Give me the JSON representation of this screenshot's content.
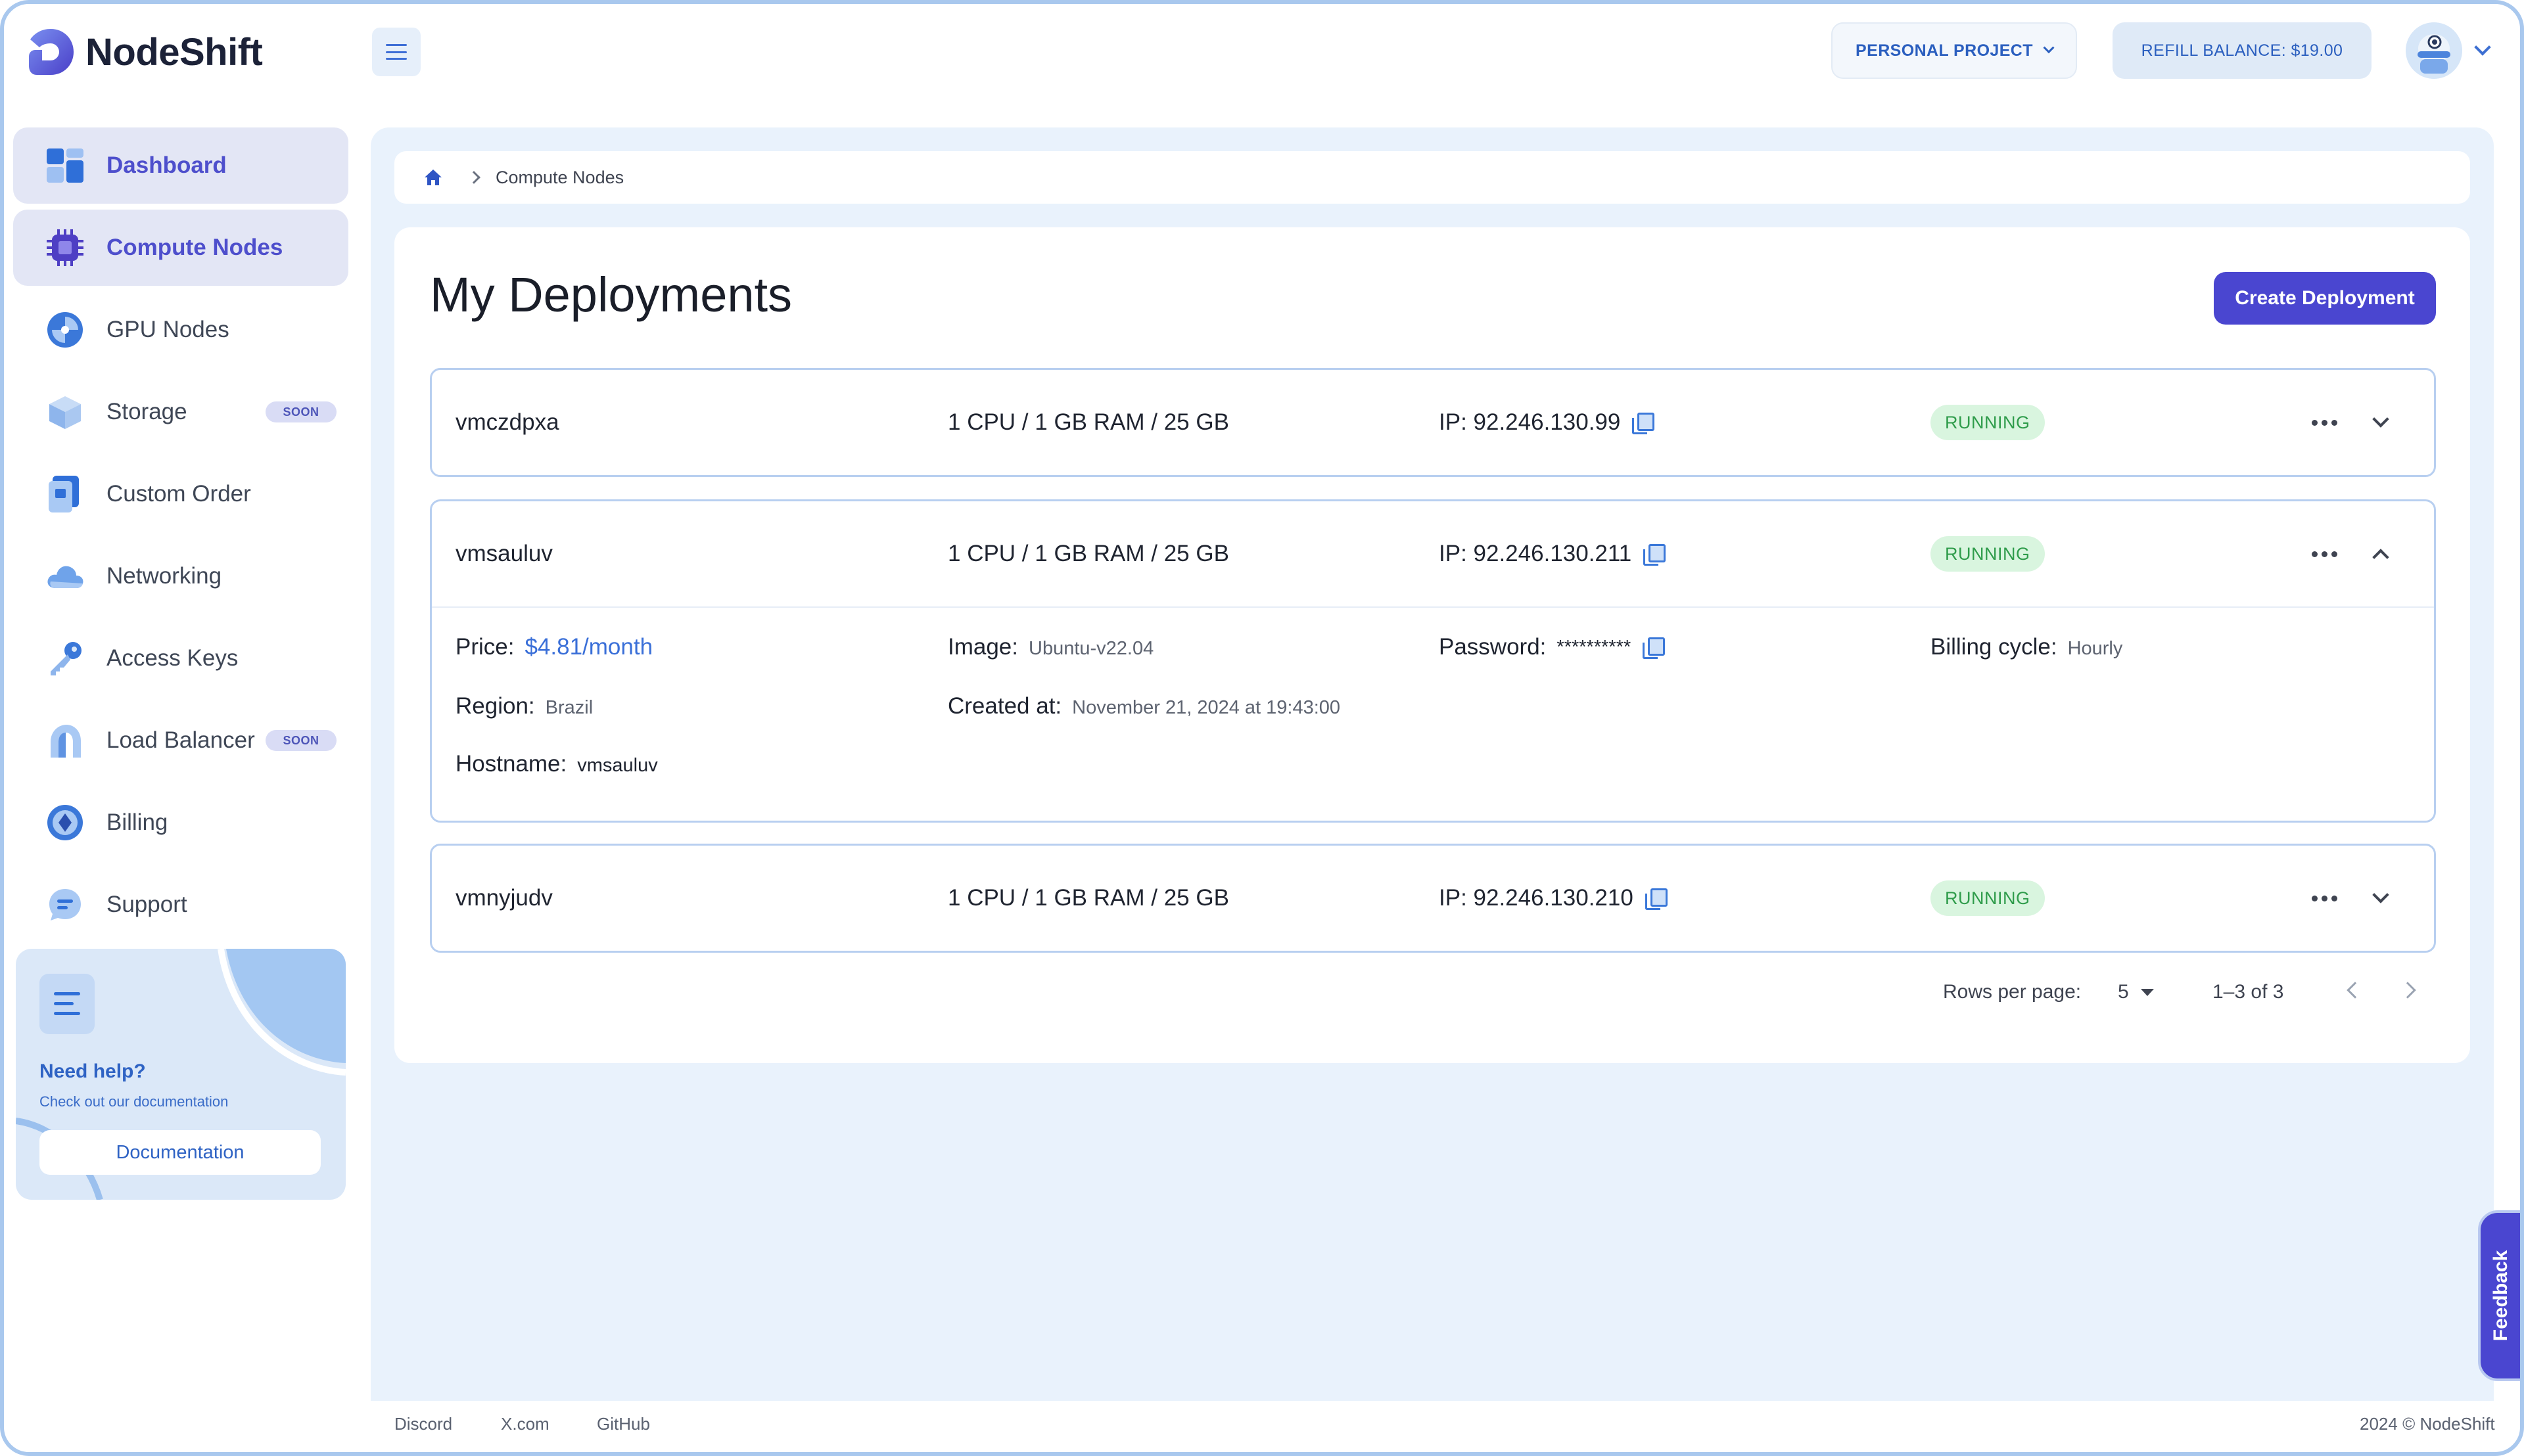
{
  "brand": {
    "name": "NodeShift"
  },
  "header": {
    "project_label": "PERSONAL PROJECT",
    "refill_label": "REFILL BALANCE: $19.00"
  },
  "sidebar": {
    "items": [
      {
        "label": "Dashboard",
        "icon": "dashboard-icon",
        "active": true
      },
      {
        "label": "Compute Nodes",
        "icon": "chip-icon",
        "active": true
      },
      {
        "label": "GPU Nodes",
        "icon": "gpu-icon"
      },
      {
        "label": "Storage",
        "icon": "storage-cube-icon",
        "badge": "SOON"
      },
      {
        "label": "Custom Order",
        "icon": "custom-order-icon"
      },
      {
        "label": "Networking",
        "icon": "cloud-icon"
      },
      {
        "label": "Access Keys",
        "icon": "key-icon"
      },
      {
        "label": "Load Balancer",
        "icon": "load-balancer-icon",
        "badge": "SOON"
      },
      {
        "label": "Billing",
        "icon": "billing-icon"
      },
      {
        "label": "Support",
        "icon": "support-icon"
      }
    ],
    "help": {
      "title": "Need help?",
      "subtitle": "Check out our documentation",
      "button": "Documentation"
    }
  },
  "breadcrumb": {
    "current": "Compute Nodes"
  },
  "page": {
    "title": "My Deployments",
    "create_button": "Create Deployment"
  },
  "deployments": [
    {
      "name": "vmczdpxa",
      "specs": "1 CPU / 1 GB RAM / 25 GB",
      "ip": "IP: 92.246.130.99",
      "status": "RUNNING",
      "expanded": false
    },
    {
      "name": "vmsauluv",
      "specs": "1 CPU / 1 GB RAM / 25 GB",
      "ip": "IP: 92.246.130.211",
      "status": "RUNNING",
      "expanded": true,
      "details": {
        "price_label": "Price:",
        "price": "$4.81/month",
        "image_label": "Image:",
        "image": "Ubuntu-v22.04",
        "password_label": "Password:",
        "password": "**********",
        "billing_label": "Billing cycle:",
        "billing": "Hourly",
        "region_label": "Region:",
        "region": "Brazil",
        "created_label": "Created at:",
        "created": "November 21, 2024 at 19:43:00",
        "hostname_label": "Hostname:",
        "hostname": "vmsauluv"
      }
    },
    {
      "name": "vmnyjudv",
      "specs": "1 CPU / 1 GB RAM / 25 GB",
      "ip": "IP: 92.246.130.210",
      "status": "RUNNING",
      "expanded": false
    }
  ],
  "pagination": {
    "rows_label": "Rows per page:",
    "rows_value": "5",
    "range": "1–3 of 3"
  },
  "footer": {
    "links": [
      "Discord",
      "X.com",
      "GitHub"
    ],
    "copyright": "2024 © NodeShift"
  },
  "feedback": {
    "label": "Feedback"
  },
  "colors": {
    "accent": "#4a46d0",
    "link": "#3a6fd8",
    "running_bg": "#d9f5df",
    "running_text": "#2f9c4b"
  }
}
